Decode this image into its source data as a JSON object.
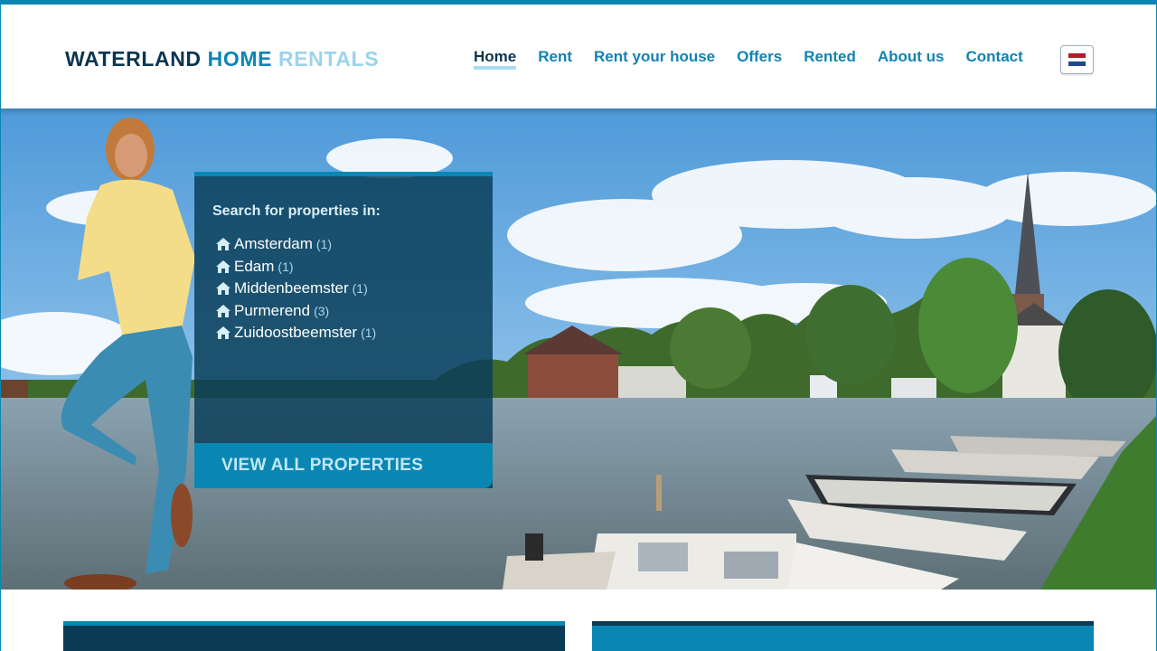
{
  "brand": {
    "part1": "WATERLAND",
    "part2": "HOME",
    "part3": "RENTALS"
  },
  "nav": {
    "items": [
      {
        "label": "Home",
        "active": true
      },
      {
        "label": "Rent",
        "active": false
      },
      {
        "label": "Rent your house",
        "active": false
      },
      {
        "label": "Offers",
        "active": false
      },
      {
        "label": "Rented",
        "active": false
      },
      {
        "label": "About us",
        "active": false
      },
      {
        "label": "Contact",
        "active": false
      }
    ]
  },
  "language": {
    "icon": "netherlands-flag-icon",
    "colors": [
      "#ae1c28",
      "#ffffff",
      "#21468b"
    ]
  },
  "search_panel": {
    "title": "Search for properties in:",
    "locations": [
      {
        "name": "Amsterdam",
        "count": "(1)"
      },
      {
        "name": "Edam",
        "count": "(1)"
      },
      {
        "name": "Middenbeemster",
        "count": "(1)"
      },
      {
        "name": "Purmerend",
        "count": "(3)"
      },
      {
        "name": "Zuidoostbeemster",
        "count": "(1)"
      }
    ],
    "location_icon": "home-icon",
    "view_all_label": "VIEW ALL PROPERTIES"
  },
  "colors": {
    "accent": "#0a86b3",
    "dark": "#0b3550",
    "light": "#9cd3ee"
  }
}
